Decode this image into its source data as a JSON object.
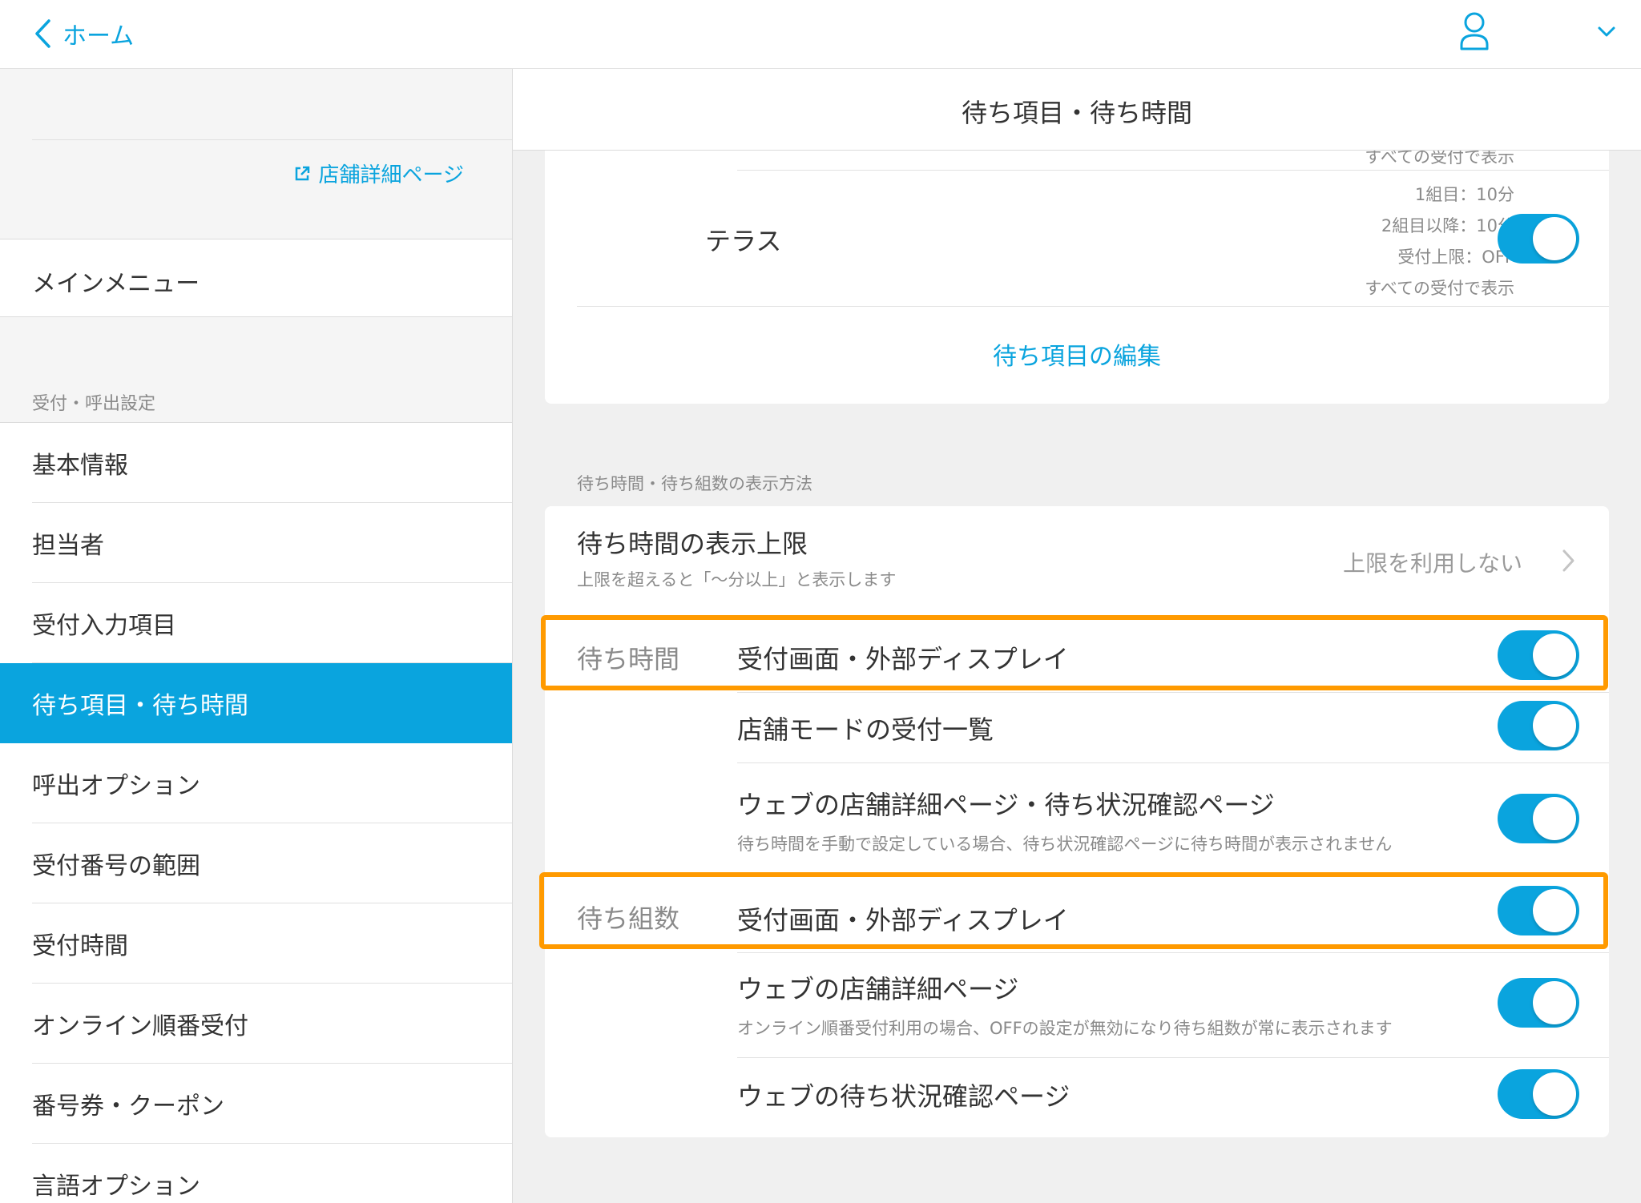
{
  "header": {
    "back_label": "ホーム"
  },
  "sidebar": {
    "store_link_label": "店舗詳細ページ",
    "main_menu_label": "メインメニュー",
    "section_label": "受付・呼出設定",
    "items": [
      {
        "label": "基本情報"
      },
      {
        "label": "担当者"
      },
      {
        "label": "受付入力項目"
      },
      {
        "label": "待ち項目・待ち時間",
        "active": true
      },
      {
        "label": "呼出オプション"
      },
      {
        "label": "受付番号の範囲"
      },
      {
        "label": "受付時間"
      },
      {
        "label": "オンライン順番受付"
      },
      {
        "label": "番号券・クーポン"
      },
      {
        "label": "言語オプション"
      }
    ]
  },
  "main": {
    "title": "待ち項目・待ち時間",
    "wait_items": {
      "cut_text": "すべての受付で表示",
      "terrace": {
        "label": "テラス",
        "details": [
          "1組目：10分",
          "2組目以降：10分",
          "受付上限：OFF",
          "すべての受付で表示"
        ],
        "enabled": true
      },
      "edit_link": "待ち項目の編集"
    },
    "display_section_label": "待ち時間・待ち組数の表示方法",
    "limit": {
      "label": "待ち時間の表示上限",
      "sub": "上限を超えると「〜分以上」と表示します",
      "value": "上限を利用しない"
    },
    "wait_time": {
      "group_label": "待ち時間",
      "rows": [
        {
          "label": "受付画面・外部ディスプレイ",
          "sub": "",
          "on": true
        },
        {
          "label": "店舗モードの受付一覧",
          "sub": "",
          "on": true
        },
        {
          "label": "ウェブの店舗詳細ページ・待ち状況確認ページ",
          "sub": "待ち時間を手動で設定している場合、待ち状況確認ページに待ち時間が表示されません",
          "on": true
        }
      ]
    },
    "wait_count": {
      "group_label": "待ち組数",
      "rows": [
        {
          "label": "受付画面・外部ディスプレイ",
          "sub": "",
          "on": true
        },
        {
          "label": "ウェブの店舗詳細ページ",
          "sub": "オンライン順番受付利用の場合、OFFの設定が無効になり待ち組数が常に表示されます",
          "on": true
        },
        {
          "label": "ウェブの待ち状況確認ページ",
          "sub": "",
          "on": true
        }
      ]
    }
  },
  "colors": {
    "accent": "#0aa4de",
    "highlight": "#ff9a00"
  }
}
